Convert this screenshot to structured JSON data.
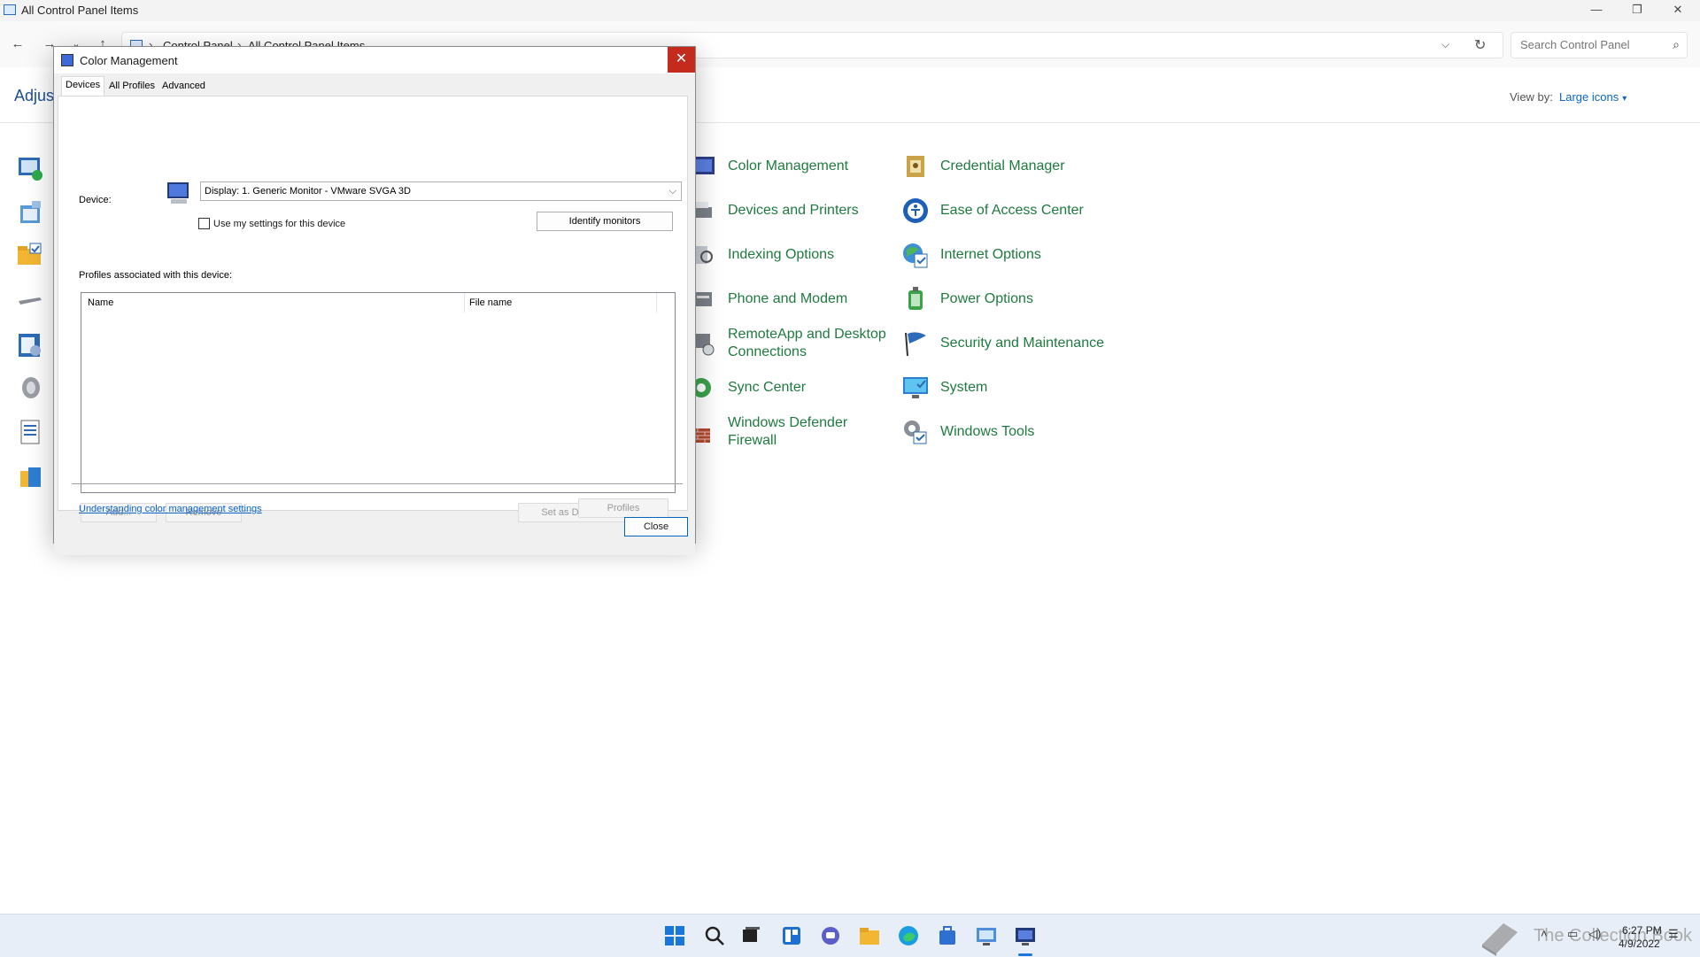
{
  "window": {
    "title": "All Control Panel Items",
    "breadcrumb": [
      "Control Panel",
      "All Control Panel Items"
    ],
    "search_placeholder": "Search Control Panel",
    "heading_partial": "Adjust",
    "view_by_label": "View by:",
    "view_by_value": "Large icons"
  },
  "items": [
    {
      "label": "Color Management",
      "icon": "color-management-icon"
    },
    {
      "label": "Credential Manager",
      "icon": "credential-manager-icon"
    },
    {
      "label": "Devices and Printers",
      "icon": "devices-printers-icon"
    },
    {
      "label": "Ease of Access Center",
      "icon": "ease-of-access-icon"
    },
    {
      "label": "Indexing Options",
      "icon": "indexing-options-icon"
    },
    {
      "label": "Internet Options",
      "icon": "internet-options-icon"
    },
    {
      "label": "Phone and Modem",
      "icon": "phone-modem-icon"
    },
    {
      "label": "Power Options",
      "icon": "power-options-icon"
    },
    {
      "label": "RemoteApp and Desktop Connections",
      "icon": "remoteapp-icon"
    },
    {
      "label": "Security and Maintenance",
      "icon": "security-flag-icon"
    },
    {
      "label": "Sync Center",
      "icon": "sync-center-icon"
    },
    {
      "label": "System",
      "icon": "system-monitor-icon"
    },
    {
      "label": "Windows Defender Firewall",
      "icon": "firewall-icon"
    },
    {
      "label": "Windows Tools",
      "icon": "windows-tools-icon"
    }
  ],
  "dialog": {
    "title": "Color Management",
    "tabs": [
      "Devices",
      "All Profiles",
      "Advanced"
    ],
    "device_label": "Device:",
    "device_value": "Display: 1. Generic Monitor - VMware SVGA 3D",
    "use_my_settings": "Use my settings for this device",
    "identify_monitors": "Identify monitors",
    "profiles_label": "Profiles associated with this device:",
    "columns": [
      "Name",
      "File name"
    ],
    "add": "Add...",
    "remove": "Remove",
    "set_default": "Set as Default Profile",
    "profiles_button": "Profiles",
    "help_link": "Understanding color management settings",
    "close": "Close"
  },
  "taskbar": {
    "time": "6:27 PM",
    "date": "4/9/2022",
    "watermark": "The Collection Book"
  },
  "colors": {
    "item_text": "#1f7a3f",
    "link": "#0a64c8",
    "close_red": "#c42b1c"
  }
}
